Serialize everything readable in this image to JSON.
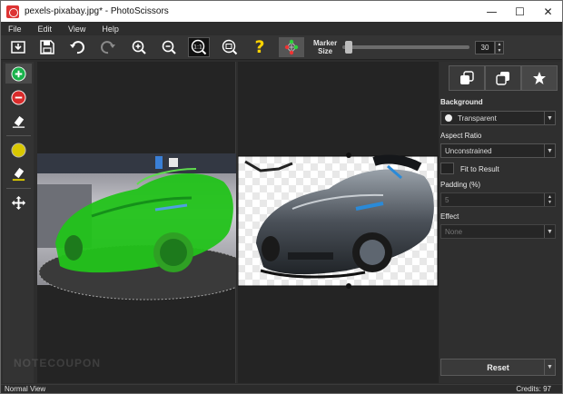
{
  "window": {
    "title": "pexels-pixabay.jpg* - PhotoScissors",
    "controls": [
      "minimize",
      "maximize",
      "close"
    ]
  },
  "menu": {
    "items": [
      "File",
      "Edit",
      "View",
      "Help"
    ]
  },
  "toolbar": {
    "icons": [
      "open-icon",
      "save-icon",
      "undo-icon",
      "redo-icon",
      "zoom-in-icon",
      "zoom-out-icon",
      "actual-size-icon",
      "fit-window-icon",
      "help-icon",
      "share-icon"
    ],
    "actual_size_label": "1:1",
    "help_label": "?",
    "marker_label": "Marker\nSize",
    "marker_size": "30"
  },
  "palette": {
    "tools": [
      "add-marker-tool",
      "remove-marker-tool",
      "eraser-tool",
      "color-marker-tool",
      "color-eraser-tool",
      "move-tool"
    ],
    "colors": {
      "add": "#19b24b",
      "remove": "#d92b2b",
      "highlight": "#d9c800"
    }
  },
  "panel": {
    "tabs": [
      "tab-foreground",
      "tab-background",
      "tab-effects"
    ],
    "background_label": "Background",
    "background_value": "Transparent",
    "aspect_label": "Aspect Ratio",
    "aspect_value": "Unconstrained",
    "fit_label": "Fit to Result",
    "padding_label": "Padding (%)",
    "padding_value": "5",
    "effect_label": "Effect",
    "effect_value": "None",
    "reset_label": "Reset"
  },
  "status": {
    "view_mode": "Normal View",
    "credits": "Credits: 97"
  },
  "watermark": "NOTECOUPON",
  "colors": {
    "mask_green": "#22c31a",
    "car_gray": "#5a6066",
    "accent_blue": "#2a8ad8"
  }
}
